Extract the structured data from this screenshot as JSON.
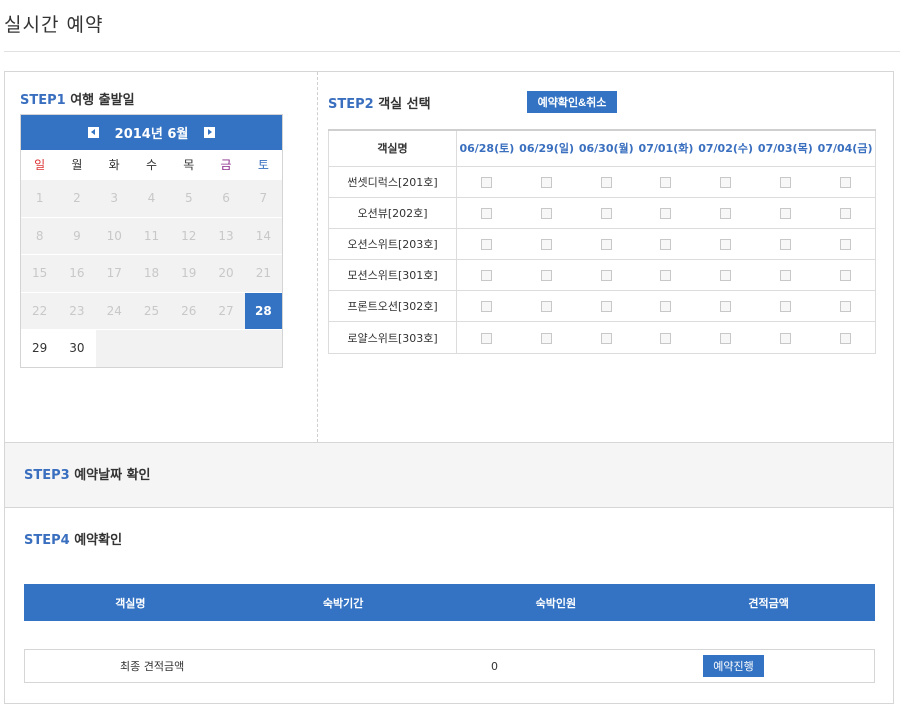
{
  "page": {
    "title": "실시간 예약"
  },
  "step1": {
    "num": "STEP1",
    "label": "여행 출발일",
    "calendar": {
      "month_label": "2014년 6월",
      "weekdays": [
        "일",
        "월",
        "화",
        "수",
        "목",
        "금",
        "토"
      ],
      "selected_day": "28",
      "weeks": [
        [
          {
            "d": "1",
            "s": "past"
          },
          {
            "d": "2",
            "s": "past"
          },
          {
            "d": "3",
            "s": "past"
          },
          {
            "d": "4",
            "s": "past"
          },
          {
            "d": "5",
            "s": "past"
          },
          {
            "d": "6",
            "s": "past"
          },
          {
            "d": "7",
            "s": "past"
          }
        ],
        [
          {
            "d": "8",
            "s": "past"
          },
          {
            "d": "9",
            "s": "past"
          },
          {
            "d": "10",
            "s": "past"
          },
          {
            "d": "11",
            "s": "past"
          },
          {
            "d": "12",
            "s": "past"
          },
          {
            "d": "13",
            "s": "past"
          },
          {
            "d": "14",
            "s": "past"
          }
        ],
        [
          {
            "d": "15",
            "s": "past"
          },
          {
            "d": "16",
            "s": "past"
          },
          {
            "d": "17",
            "s": "past"
          },
          {
            "d": "18",
            "s": "past"
          },
          {
            "d": "19",
            "s": "past"
          },
          {
            "d": "20",
            "s": "past"
          },
          {
            "d": "21",
            "s": "past"
          }
        ],
        [
          {
            "d": "22",
            "s": "past"
          },
          {
            "d": "23",
            "s": "past"
          },
          {
            "d": "24",
            "s": "past"
          },
          {
            "d": "25",
            "s": "past"
          },
          {
            "d": "26",
            "s": "past"
          },
          {
            "d": "27",
            "s": "past"
          },
          {
            "d": "28",
            "s": "selected"
          }
        ],
        [
          {
            "d": "29",
            "s": "avail"
          },
          {
            "d": "30",
            "s": "avail"
          },
          {
            "d": "",
            "s": "blank"
          },
          {
            "d": "",
            "s": "blank"
          },
          {
            "d": "",
            "s": "blank"
          },
          {
            "d": "",
            "s": "blank"
          },
          {
            "d": "",
            "s": "blank"
          }
        ]
      ]
    }
  },
  "step2": {
    "num": "STEP2",
    "label": "객실 선택",
    "confirm_button": "예약확인&취소",
    "room_col_header": "객실명",
    "dates": [
      "06/28(토)",
      "06/29(일)",
      "06/30(월)",
      "07/01(화)",
      "07/02(수)",
      "07/03(목)",
      "07/04(금)"
    ],
    "rooms": [
      "썬셋디럭스[201호]",
      "오션뷰[202호]",
      "오션스위트[203호]",
      "모션스위트[301호]",
      "프론트오션[302호]",
      "로얄스위트[303호]"
    ]
  },
  "step3": {
    "num": "STEP3",
    "label": "예약날짜 확인"
  },
  "step4": {
    "num": "STEP4",
    "label": "예약확인",
    "columns": [
      "객실명",
      "숙박기간",
      "숙박인원",
      "견적금액"
    ],
    "total_label": "최종 견적금액",
    "total_value": "0",
    "proceed_button": "예약진행"
  }
}
